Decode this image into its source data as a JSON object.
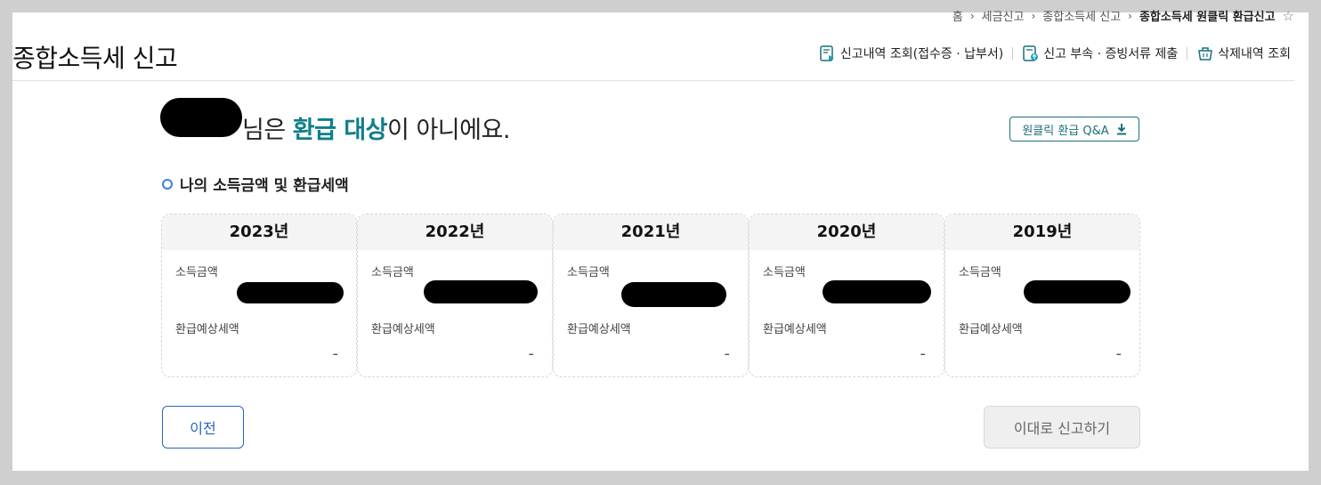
{
  "header": {
    "title": "종합소득세 신고",
    "breadcrumb": [
      "홈",
      "세금신고",
      "종합소득세 신고",
      "종합소득세 원클릭 환급신고"
    ],
    "links": [
      {
        "label": "신고내역 조회(접수증 · 납부서)",
        "icon": "document-search-icon"
      },
      {
        "label": "신고 부속 · 증빙서류 제출",
        "icon": "document-upload-icon"
      },
      {
        "label": "삭제내역 조회",
        "icon": "trash-basket-icon"
      }
    ]
  },
  "main": {
    "headline": {
      "suffix": "님은 ",
      "highlight": "환급 대상",
      "rest": "이 아니에요."
    },
    "qa_button": "원클릭 환급 Q&A",
    "section_title": "나의 소득금액 및 환급세액",
    "income_label": "소득금액",
    "refund_label": "환급예상세액",
    "years": [
      {
        "year": "2023년",
        "refund": "-"
      },
      {
        "year": "2022년",
        "refund": "-"
      },
      {
        "year": "2021년",
        "refund": "-"
      },
      {
        "year": "2020년",
        "refund": "-"
      },
      {
        "year": "2019년",
        "refund": "-"
      }
    ]
  },
  "footer": {
    "prev": "이전",
    "submit": "이대로 신고하기"
  },
  "colors": {
    "accent": "#0e7f8a",
    "primary": "#2a64c0"
  }
}
